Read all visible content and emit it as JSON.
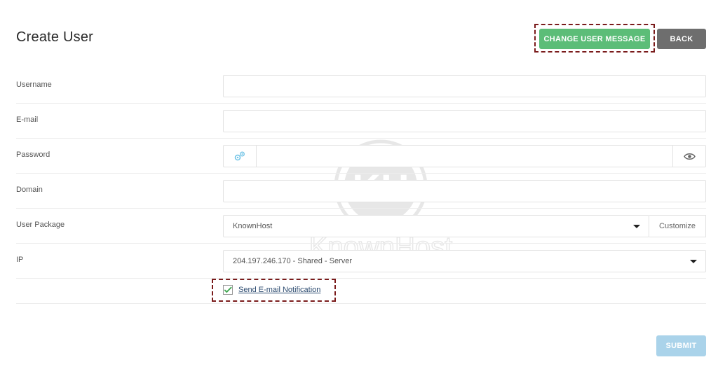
{
  "page": {
    "title": "Create User"
  },
  "header": {
    "change_message_label": "CHANGE USER MESSAGE",
    "back_label": "BACK"
  },
  "form": {
    "username": {
      "label": "Username",
      "value": ""
    },
    "email": {
      "label": "E-mail",
      "value": ""
    },
    "password": {
      "label": "Password",
      "value": ""
    },
    "domain": {
      "label": "Domain",
      "value": ""
    },
    "package": {
      "label": "User Package",
      "selected": "KnownHost",
      "customize_label": "Customize"
    },
    "ip": {
      "label": "IP",
      "selected": "204.197.246.170 - Shared - Server"
    },
    "notification": {
      "label": "Send E-mail Notification",
      "checked": true
    }
  },
  "footer": {
    "submit_label": "SUBMIT"
  },
  "watermark": {
    "brand": "KnownHost",
    "initials": "KH"
  },
  "colors": {
    "accent_green": "#5cbd78",
    "back_gray": "#6e6e6e",
    "submit_blue": "#aad3ea",
    "highlight": "#7a1b1b",
    "checkmark": "#3fa650"
  }
}
